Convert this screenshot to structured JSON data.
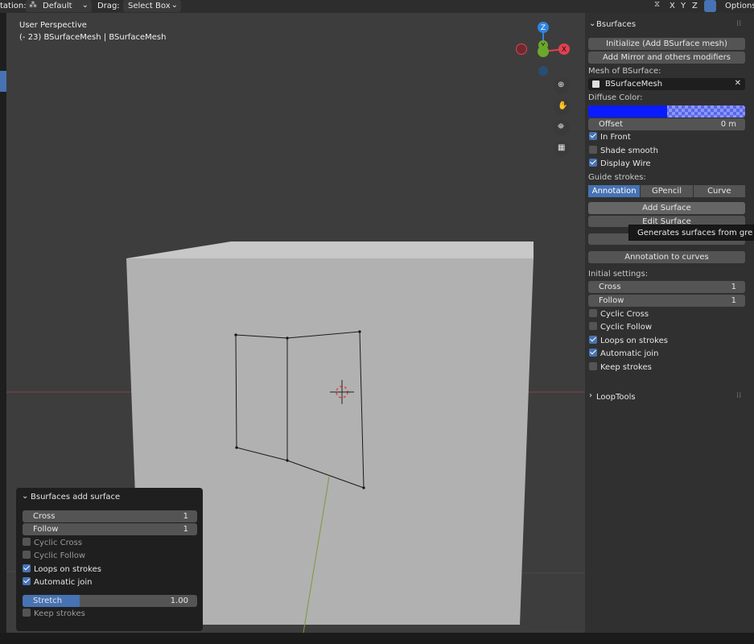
{
  "topbar": {
    "orientation_label": "tation:",
    "orientation_value": "Default",
    "drag_label": "Drag:",
    "drag_value": "Select Box",
    "axes": [
      "X",
      "Y",
      "Z"
    ],
    "options_label": "Options"
  },
  "viewport": {
    "view_name": "User Perspective",
    "object_info": "(- 23) BSurfaceMesh | BSurfaceMesh",
    "gizmo_axes": {
      "z": "Z",
      "y": "Y",
      "x": "X"
    }
  },
  "panel": {
    "title": "Bsurfaces",
    "initialize_button": "Initialize (Add BSurface mesh)",
    "mirror_button": "Add Mirror and others modifiers",
    "mesh_label": "Mesh of BSurface:",
    "mesh_value": "BSurfaceMesh",
    "diffuse_label": "Diffuse Color:",
    "offset_label": "Offset",
    "offset_value": "0 m",
    "in_front": "In Front",
    "shade_smooth": "Shade smooth",
    "display_wire": "Display Wire",
    "guide_label": "Guide strokes:",
    "guide_tabs": [
      "Annotation",
      "GPencil",
      "Curve"
    ],
    "add_surface_button": "Add Surface",
    "edit_surface_button": "Edit Surface",
    "annotation_to_curves_button": "Annotation to curves",
    "initial_label": "Initial settings:",
    "cross_label": "Cross",
    "cross_value": "1",
    "follow_label": "Follow",
    "follow_value": "1",
    "cyclic_cross": "Cyclic Cross",
    "cyclic_follow": "Cyclic Follow",
    "loops_on_strokes": "Loops on strokes",
    "automatic_join": "Automatic join",
    "keep_strokes": "Keep strokes",
    "looptools_title": "LoopTools"
  },
  "tooltip": {
    "text": "Generates surfaces from grease"
  },
  "redo_panel": {
    "title": "Bsurfaces add surface",
    "cross_label": "Cross",
    "cross_value": "1",
    "follow_label": "Follow",
    "follow_value": "1",
    "cyclic_cross": "Cyclic Cross",
    "cyclic_follow": "Cyclic Follow",
    "loops_on_strokes": "Loops on strokes",
    "automatic_join": "Automatic join",
    "stretch_label": "Stretch",
    "stretch_value": "1.00",
    "keep_strokes": "Keep strokes"
  },
  "colors": {
    "accent": "#4772b3",
    "diffuse": "#0a1cff",
    "axis_x": "#e3404f",
    "axis_y": "#6ba72c",
    "axis_z": "#2f84e0"
  }
}
